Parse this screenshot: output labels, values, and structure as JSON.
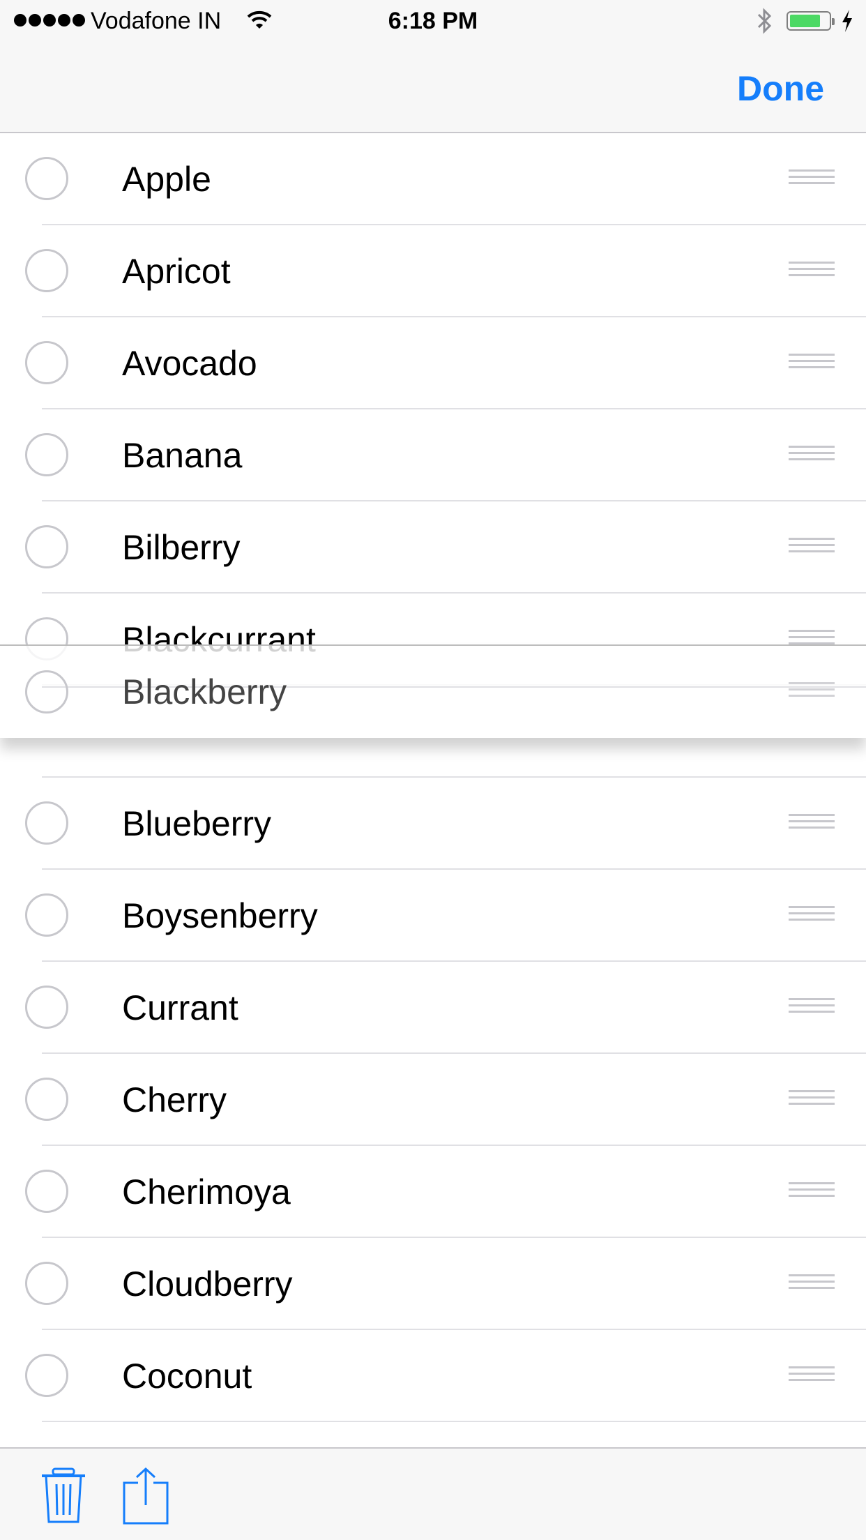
{
  "status_bar": {
    "carrier": "Vodafone IN",
    "time": "6:18 PM",
    "battery_level": 0.8,
    "icons": [
      "signal-dots-icon",
      "wifi-icon",
      "bluetooth-icon",
      "battery-icon",
      "charging-icon"
    ]
  },
  "nav": {
    "done_label": "Done"
  },
  "list": {
    "items_above": [
      "Apple",
      "Apricot",
      "Avocado",
      "Banana",
      "Bilberry",
      "Blackcurrant"
    ],
    "dragging_item": "Blackberry",
    "items_below": [
      "Blueberry",
      "Boysenberry",
      "Currant",
      "Cherry",
      "Cherimoya",
      "Cloudberry",
      "Coconut"
    ]
  },
  "toolbar": {
    "icons": [
      "trash-icon",
      "share-icon"
    ]
  },
  "colors": {
    "accent": "#157efb",
    "battery": "#4cd964"
  }
}
